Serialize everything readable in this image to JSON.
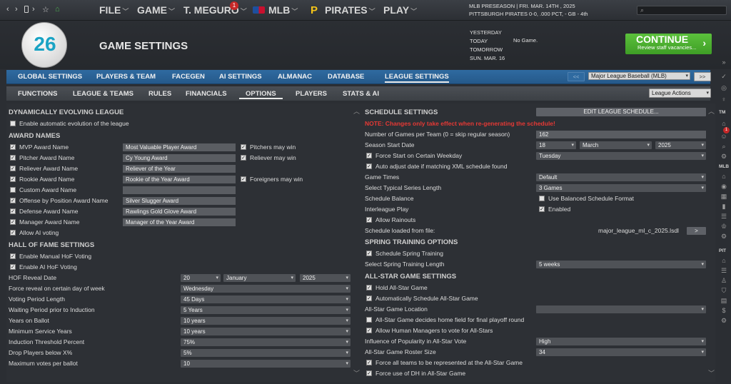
{
  "topbar": {
    "icons": [
      "chevron-left-icon",
      "window-icon",
      "back-icon",
      "star-icon",
      "home-icon"
    ],
    "menus": [
      {
        "label": "FILE"
      },
      {
        "label": "GAME"
      },
      {
        "label": "T. MEGURO",
        "badge": "1"
      },
      {
        "label": "MLB"
      },
      {
        "label": "PIRATES"
      },
      {
        "label": "PLAY"
      }
    ],
    "game_line1": "MLB PRESEASON | FRI. MAR. 14TH , 2025",
    "game_line2": "PITTSBURGH PIRATES  0-0, .000 PCT, - GB - 4th",
    "search_placeholder": ""
  },
  "header": {
    "logo_text": "26",
    "title": "GAME SETTINGS",
    "days": [
      "YESTERDAY",
      "TODAY",
      "TOMORROW",
      "SUN. MAR. 16"
    ],
    "today_note": "No Game.",
    "continue_label": "CONTINUE",
    "continue_sub": "Review staff vacancies...",
    "continue_arrow": "›"
  },
  "nav1": {
    "tabs": [
      "GLOBAL SETTINGS",
      "PLAYERS & TEAM",
      "FACEGEN",
      "AI SETTINGS",
      "ALMANAC",
      "DATABASE",
      "LEAGUE SETTINGS"
    ],
    "prev": "<<",
    "league": "Major League Baseball (MLB)",
    "next": ">>"
  },
  "nav2": {
    "tabs": [
      "FUNCTIONS",
      "LEAGUE & TEAMS",
      "RULES",
      "FINANCIALS",
      "OPTIONS",
      "PLAYERS",
      "STATS & AI"
    ],
    "actions": "League Actions"
  },
  "left": {
    "sec_dynamic": "DYNAMICALLY EVOLVING LEAGUE",
    "auto_evolution": "Enable automatic evolution of the league",
    "sec_awards": "AWARD NAMES",
    "awards": [
      {
        "label": "MVP Award Name",
        "value": "Most Valuable Player Award",
        "checked": true
      },
      {
        "label": "Pitcher Award Name",
        "value": "Cy Young Award",
        "checked": true
      },
      {
        "label": "Reliever Award Name",
        "value": "Reliever of the Year",
        "checked": true
      },
      {
        "label": "Rookie Award Name",
        "value": "Rookie of the Year Award",
        "checked": true
      },
      {
        "label": "Custom Award Name",
        "value": "",
        "checked": false
      },
      {
        "label": "Offense by Position Award Name",
        "value": "Silver Slugger Award",
        "checked": true
      },
      {
        "label": "Defense Award Name",
        "value": "Rawlings Gold Glove Award",
        "checked": true
      },
      {
        "label": "Manager Award Name",
        "value": "Manager of the Year Award",
        "checked": true
      }
    ],
    "allow_ai_voting": "Allow AI voting",
    "pitchers_may_win": "Pitchers may win",
    "relievers_may_win": "Reliever may win",
    "foreigners_may_win": "Foreigners may win",
    "sec_hof": "HALL OF FAME SETTINGS",
    "manual_hof": "Enable Manual HoF Voting",
    "ai_hof": "Enable AI HoF Voting",
    "hof_reveal_date": "HOF Reveal Date",
    "hof_day": "20",
    "hof_month": "January",
    "hof_year": "2025",
    "rows": [
      {
        "label": "Force reveal on certain day of week",
        "value": "Wednesday"
      },
      {
        "label": "Voting Period Length",
        "value": "45 Days"
      },
      {
        "label": "Waiting Period prior to Induction",
        "value": "5 Years"
      },
      {
        "label": "Years on Ballot",
        "value": "10 years"
      },
      {
        "label": "Minimum Service Years",
        "value": "10 years"
      },
      {
        "label": "Induction Threshold Percent",
        "value": "75%"
      },
      {
        "label": "Drop Players below X%",
        "value": "5%"
      },
      {
        "label": "Maximum votes per ballot",
        "value": "10"
      }
    ]
  },
  "right": {
    "sec_schedule": "SCHEDULE SETTINGS",
    "edit_schedule": "EDIT LEAGUE SCHEDULE...",
    "note": "NOTE: Changes only take effect when re-generating the schedule!",
    "games_per_team_label": "Number of Games per Team (0 = skip regular season)",
    "games_per_team": "162",
    "start_date_label": "Season Start Date",
    "start_day": "18",
    "start_month": "March",
    "start_year": "2025",
    "force_start": "Force Start on Certain Weekday",
    "weekday": "Tuesday",
    "auto_adjust": "Auto adjust date if matching XML schedule found",
    "game_times_label": "Game Times",
    "game_times": "Default",
    "series_label": "Select Typical Series Length",
    "series": "3 Games",
    "balance_label": "Schedule Balance",
    "balance_option": "Use Balanced Schedule Format",
    "interleague_label": "Interleague Play",
    "interleague_option": "Enabled",
    "allow_rainouts": "Allow Rainouts",
    "loaded_label": "Schedule loaded from file:",
    "loaded_file": "major_league_ml_c_2025.lsdl",
    "loaded_btn": ">",
    "sec_spring": "SPRING TRAINING OPTIONS",
    "schedule_spring": "Schedule Spring Training",
    "spring_length_label": "Select Spring Training Length",
    "spring_length": "5 weeks",
    "sec_allstar": "ALL-STAR GAME SETTINGS",
    "hold_allstar": "Hold All-Star Game",
    "auto_allstar": "Automatically Schedule All-Star Game",
    "location_label": "All-Star Game Location",
    "location": "",
    "home_field": "All-Star Game decides home field for final playoff round",
    "human_managers": "Allow Human Managers to vote for All-Stars",
    "influence_label": "Influence of Popularity in All-Star Vote",
    "influence": "High",
    "roster_label": "All-Star Game Roster Size",
    "roster": "34",
    "all_teams": "Force all teams to be represented at the All-Star Game",
    "force_dh": "Force use of DH in All-Star Game"
  },
  "sidebar": {
    "labels": [
      "TM",
      "MLB",
      "PIT"
    ],
    "badge": "1"
  },
  "colors": {
    "accent": "#2f6aa0",
    "continue": "#4caf30",
    "note": "#e53935"
  }
}
